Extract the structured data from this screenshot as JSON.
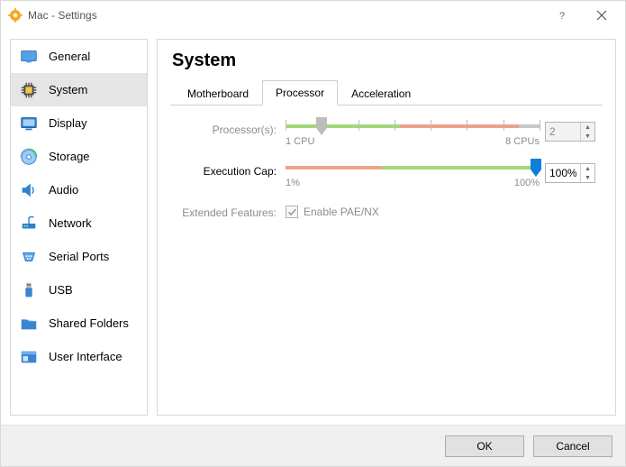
{
  "window": {
    "title": "Mac - Settings"
  },
  "sidebar": {
    "items": [
      {
        "label": "General"
      },
      {
        "label": "System"
      },
      {
        "label": "Display"
      },
      {
        "label": "Storage"
      },
      {
        "label": "Audio"
      },
      {
        "label": "Network"
      },
      {
        "label": "Serial Ports"
      },
      {
        "label": "USB"
      },
      {
        "label": "Shared Folders"
      },
      {
        "label": "User Interface"
      }
    ],
    "selected_index": 1
  },
  "main": {
    "title": "System",
    "tabs": [
      {
        "label": "Motherboard"
      },
      {
        "label": "Processor"
      },
      {
        "label": "Acceleration"
      }
    ],
    "active_tab": 1,
    "processor": {
      "processors_label": "Processor(s):",
      "processors_value": "2",
      "processors_min_label": "1 CPU",
      "processors_max_label": "8 CPUs",
      "exec_cap_label": "Execution Cap:",
      "exec_cap_value": "100%",
      "exec_cap_min_label": "1%",
      "exec_cap_max_label": "100%",
      "extended_label": "Extended Features:",
      "pae_label": "Enable PAE/NX",
      "pae_checked": true
    }
  },
  "footer": {
    "ok": "OK",
    "cancel": "Cancel"
  }
}
